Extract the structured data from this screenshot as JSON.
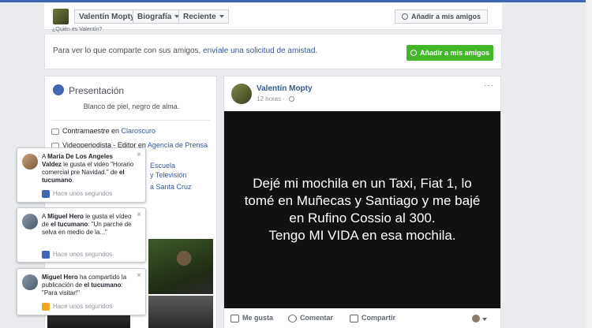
{
  "timeline_header": {
    "name": "Valentín Mopty",
    "tab_biografia": "Biografía",
    "tab_reciente": "Reciente",
    "add_friend": "Añadir a mis amigos",
    "cut_text": "¿Quién es Valentín?"
  },
  "friend_prompt": {
    "text": "Para ver lo que comparte con sus amigos, ",
    "link": "envíale una solicitud de amistad.",
    "button": "Añadir a mis amigos"
  },
  "intro": {
    "title": "Presentación",
    "bio": "Blanco de piel, negro de alma.",
    "work1_prefix": "Contramaestre en ",
    "work1_link": "Claroscuro",
    "work2_prefix": "Videoperiodista - Editor en ",
    "work2_link": "Agencia de Prensa",
    "frag_escuela": "Escuela",
    "frag_television": "y Televisión",
    "frag_santa_cruz": "a Santa Cruz"
  },
  "post": {
    "author": "Valentín Mopty",
    "time": "12 horas · ",
    "more": "···",
    "image_text": "Dejé mi mochila en un Taxi, Fiat 1, lo tomé en Muñecas y Santiago y me bajé en Rufino Cossio al 300.\nTengo MI VIDA en esa mochila.",
    "like": "Me gusta",
    "comment": "Comentar",
    "share": "Compartir"
  },
  "notifications": [
    {
      "pre": "A ",
      "actor": "Maria De Los Angeles Valdez",
      "mid": " le gusta el video \"Horario comercial pre Navidad.\" de ",
      "target": "el tucumano",
      "post": ".",
      "time": "Hace unos segundos",
      "close": "×",
      "time_icon_color": "#4267b2"
    },
    {
      "pre": "A ",
      "actor": "Miguel Hero",
      "mid": " le gusta el vídeo de ",
      "target": "el tucumano",
      "post": ": \"Un parche de selva en medio de la...\"",
      "time": "Hace unos segundos",
      "close": "×",
      "time_icon_color": "#4267b2"
    },
    {
      "pre": "",
      "actor": "Miguel Hero",
      "mid": " ha compartido la publicación de ",
      "target": "el tucumano",
      "post": ": \"Para visitar!\"",
      "time": "Hace unos segundos",
      "close": "×",
      "time_icon_color": "#f5a623"
    }
  ]
}
